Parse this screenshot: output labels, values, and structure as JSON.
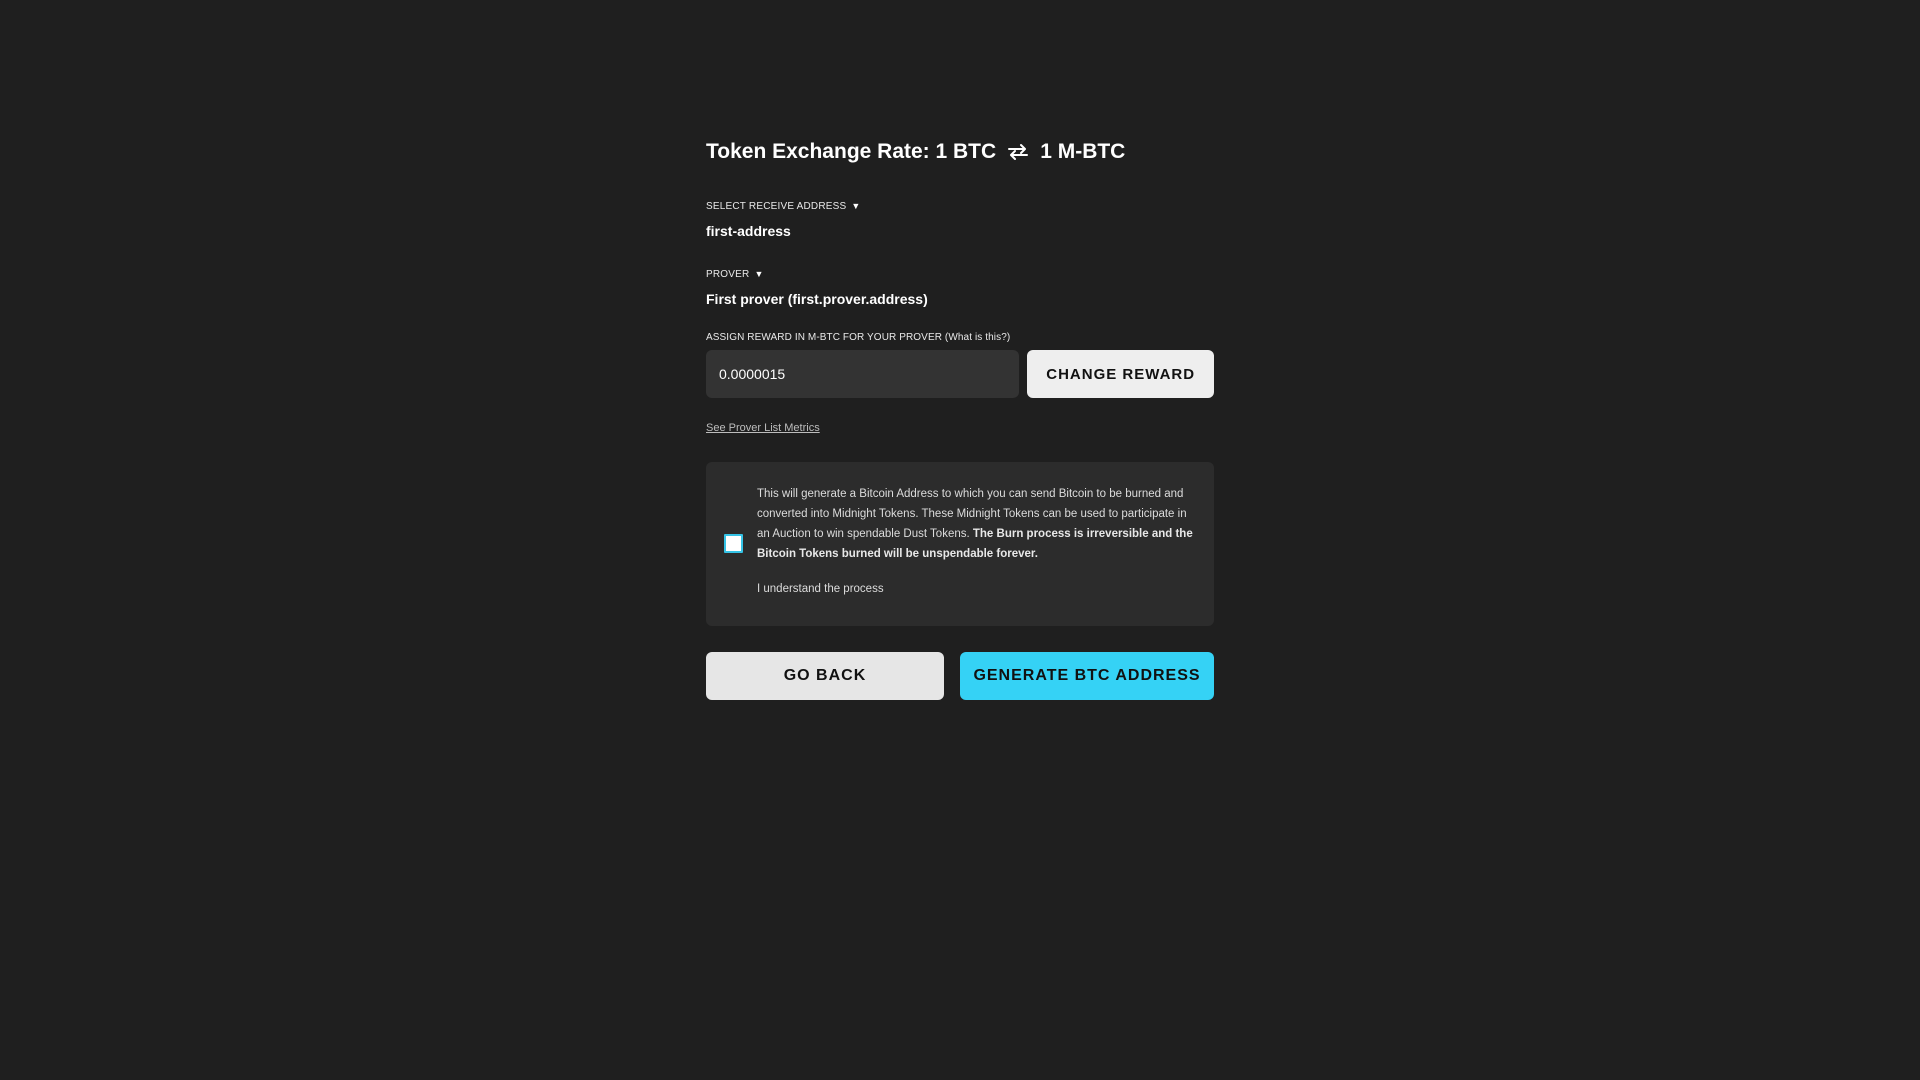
{
  "header": {
    "title_prefix": "Token Exchange Rate: 1 BTC",
    "title_suffix": "1 M-BTC",
    "swap_icon": "swap-arrows-icon"
  },
  "receive_address": {
    "label": "SELECT RECEIVE ADDRESS",
    "caret": "▼",
    "value": "first-address"
  },
  "prover": {
    "label": "PROVER",
    "caret": "▼",
    "value": "First prover (first.prover.address)"
  },
  "reward": {
    "label": "ASSIGN REWARD IN M-BTC FOR YOUR PROVER (What is this?)",
    "input_value": "0.0000015",
    "change_button": "CHANGE REWARD"
  },
  "metrics_link": "See Prover List Metrics",
  "disclaimer": {
    "text_regular": "This will generate a Bitcoin Address to which you can send Bitcoin to be burned and converted into Midnight Tokens. These Midnight Tokens can be used to participate in an Auction to win spendable Dust Tokens. ",
    "text_bold": "The Burn process is irreversible and the Bitcoin Tokens burned will be unspendable forever.",
    "checkbox_label": "I understand the process",
    "checked": false
  },
  "actions": {
    "back": "GO BACK",
    "generate": "GENERATE BTC ADDRESS"
  },
  "colors": {
    "background": "#1f1f1f",
    "accent": "#35d2f5",
    "panel": "#2c2c2c",
    "input": "#333333"
  }
}
